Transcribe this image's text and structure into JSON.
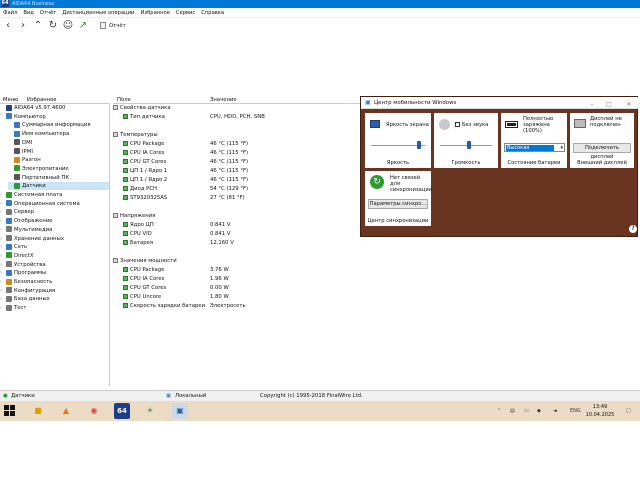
{
  "window": {
    "app_icon_label": "64",
    "title": "AIDA64 Business"
  },
  "menu": [
    "Файл",
    "Вид",
    "Отчёт",
    "Дистанционные операции",
    "Избранное",
    "Сервис",
    "Справка"
  ],
  "toolbar": {
    "report_label": "Отчёт"
  },
  "left_panel": {
    "tab_menu": "Меню",
    "tab_favorites": "Избранное"
  },
  "tree": [
    {
      "label": "AIDA64 v5.97.4600",
      "level": 0,
      "icon": "aida-icon",
      "color": "#1c3f87"
    },
    {
      "label": "Компьютер",
      "level": 0,
      "icon": "computer-icon",
      "expand": "v",
      "color": "#3a78c4"
    },
    {
      "label": "Суммарная информация",
      "level": 1,
      "icon": "summary-icon",
      "color": "#3a78c4"
    },
    {
      "label": "Имя компьютера",
      "level": 1,
      "icon": "computer-name-icon",
      "color": "#3a78c4"
    },
    {
      "label": "DMI",
      "level": 1,
      "icon": "dmi-icon",
      "color": "#555"
    },
    {
      "label": "IPMI",
      "level": 1,
      "icon": "ipmi-icon",
      "color": "#555"
    },
    {
      "label": "Разгон",
      "level": 1,
      "icon": "overclock-icon",
      "color": "#d08a1a"
    },
    {
      "label": "Электропитание",
      "level": 1,
      "icon": "power-icon",
      "color": "#2d9a2d"
    },
    {
      "label": "Портативный ПК",
      "level": 1,
      "icon": "laptop-icon",
      "color": "#555"
    },
    {
      "label": "Датчики",
      "level": 1,
      "icon": "sensor-icon",
      "color": "#2d9a2d",
      "selected": true
    },
    {
      "label": "Системная плата",
      "level": 0,
      "icon": "motherboard-icon",
      "expand": ">",
      "color": "#2d9a2d"
    },
    {
      "label": "Операционная система",
      "level": 0,
      "icon": "os-icon",
      "expand": ">",
      "color": "#3a78c4"
    },
    {
      "label": "Сервер",
      "level": 0,
      "icon": "server-icon",
      "expand": ">",
      "color": "#777"
    },
    {
      "label": "Отображение",
      "level": 0,
      "icon": "display-icon",
      "expand": ">",
      "color": "#3a78c4"
    },
    {
      "label": "Мультимедиа",
      "level": 0,
      "icon": "multimedia-icon",
      "expand": ">",
      "color": "#777"
    },
    {
      "label": "Хранение данных",
      "level": 0,
      "icon": "storage-icon",
      "expand": ">",
      "color": "#777"
    },
    {
      "label": "Сеть",
      "level": 0,
      "icon": "network-icon",
      "expand": ">",
      "color": "#3a78c4"
    },
    {
      "label": "DirectX",
      "level": 0,
      "icon": "directx-icon",
      "expand": ">",
      "color": "#2d9a2d"
    },
    {
      "label": "Устройства",
      "level": 0,
      "icon": "devices-icon",
      "expand": ">",
      "color": "#777"
    },
    {
      "label": "Программы",
      "level": 0,
      "icon": "programs-icon",
      "expand": ">",
      "color": "#3a78c4"
    },
    {
      "label": "Безопасность",
      "level": 0,
      "icon": "security-icon",
      "expand": ">",
      "color": "#d08a1a"
    },
    {
      "label": "Конфигурация",
      "level": 0,
      "icon": "config-icon",
      "expand": ">",
      "color": "#777"
    },
    {
      "label": "База данных",
      "level": 0,
      "icon": "database-icon",
      "expand": ">",
      "color": "#777"
    },
    {
      "label": "Тест",
      "level": 0,
      "icon": "test-icon",
      "expand": ">",
      "color": "#777"
    }
  ],
  "columns": {
    "field": "Поле",
    "value": "Значение"
  },
  "rows": [
    {
      "field": "Свойства датчика",
      "value": "",
      "group": true
    },
    {
      "field": "Тип датчика",
      "value": "CPU, HDD, PCH, SNB"
    },
    {
      "field": "",
      "value": "",
      "spacer": true
    },
    {
      "field": "Температуры",
      "value": "",
      "group": true
    },
    {
      "field": "CPU Package",
      "value": "46 °C  (115 °F)"
    },
    {
      "field": "CPU IA Cores",
      "value": "46 °C  (115 °F)"
    },
    {
      "field": "CPU GT Cores",
      "value": "46 °C  (115 °F)"
    },
    {
      "field": "ЦП 1 / Ядро 1",
      "value": "46 °C  (115 °F)"
    },
    {
      "field": "ЦП 1 / Ядро 2",
      "value": "46 °C  (115 °F)"
    },
    {
      "field": "Диод PCH",
      "value": "54 °C  (129 °F)"
    },
    {
      "field": "ST9320325AS",
      "value": "27 °C  (81 °F)"
    },
    {
      "field": "",
      "value": "",
      "spacer": true
    },
    {
      "field": "Напряжения",
      "value": "",
      "group": true
    },
    {
      "field": "Ядро ЦП",
      "value": "0.841 V"
    },
    {
      "field": "CPU VID",
      "value": "0.841 V"
    },
    {
      "field": "Батарея",
      "value": "12.160 V"
    },
    {
      "field": "",
      "value": "",
      "spacer": true
    },
    {
      "field": "Значения мощности",
      "value": "",
      "group": true
    },
    {
      "field": "CPU Package",
      "value": "3.76 W"
    },
    {
      "field": "CPU IA Cores",
      "value": "1.96 W"
    },
    {
      "field": "CPU GT Cores",
      "value": "0.00 W"
    },
    {
      "field": "CPU Uncore",
      "value": "1.80 W"
    },
    {
      "field": "Скорость зарядки батареи",
      "value": "Электросеть"
    }
  ],
  "mobility": {
    "title": "Центр мобильности Windows",
    "brightness": {
      "caption": "Яркость экрана",
      "label": "Яркость",
      "level_pct": 88
    },
    "volume": {
      "mute_label": "Без звука",
      "label": "Громкость",
      "level_pct": 55
    },
    "battery": {
      "status": "Полностью заряжена (100%)",
      "plan": "Высокая производ",
      "label": "Состояние батареи"
    },
    "display": {
      "status": "Дисплей не подключен",
      "button": "Подключить дисплей",
      "label": "Внешний дисплей"
    },
    "sync": {
      "status": "Нет связей для синхронизации",
      "button": "Параметры синхро...",
      "label": "Центр синхронизации"
    },
    "help_glyph": "?"
  },
  "statusbar": {
    "left": "Датчики",
    "mid": "Локальный",
    "copyright": "Copyright (c) 1995-2018 FinalWire Ltd."
  },
  "taskbar": {
    "lang": "ENG",
    "time": "13:49",
    "date": "10.04.2025"
  },
  "colors": {
    "titlebar": "#0078d7",
    "mobility_bg": "#6a3520",
    "taskbar": "#ecdcc6",
    "selection": "#cce4f7"
  }
}
